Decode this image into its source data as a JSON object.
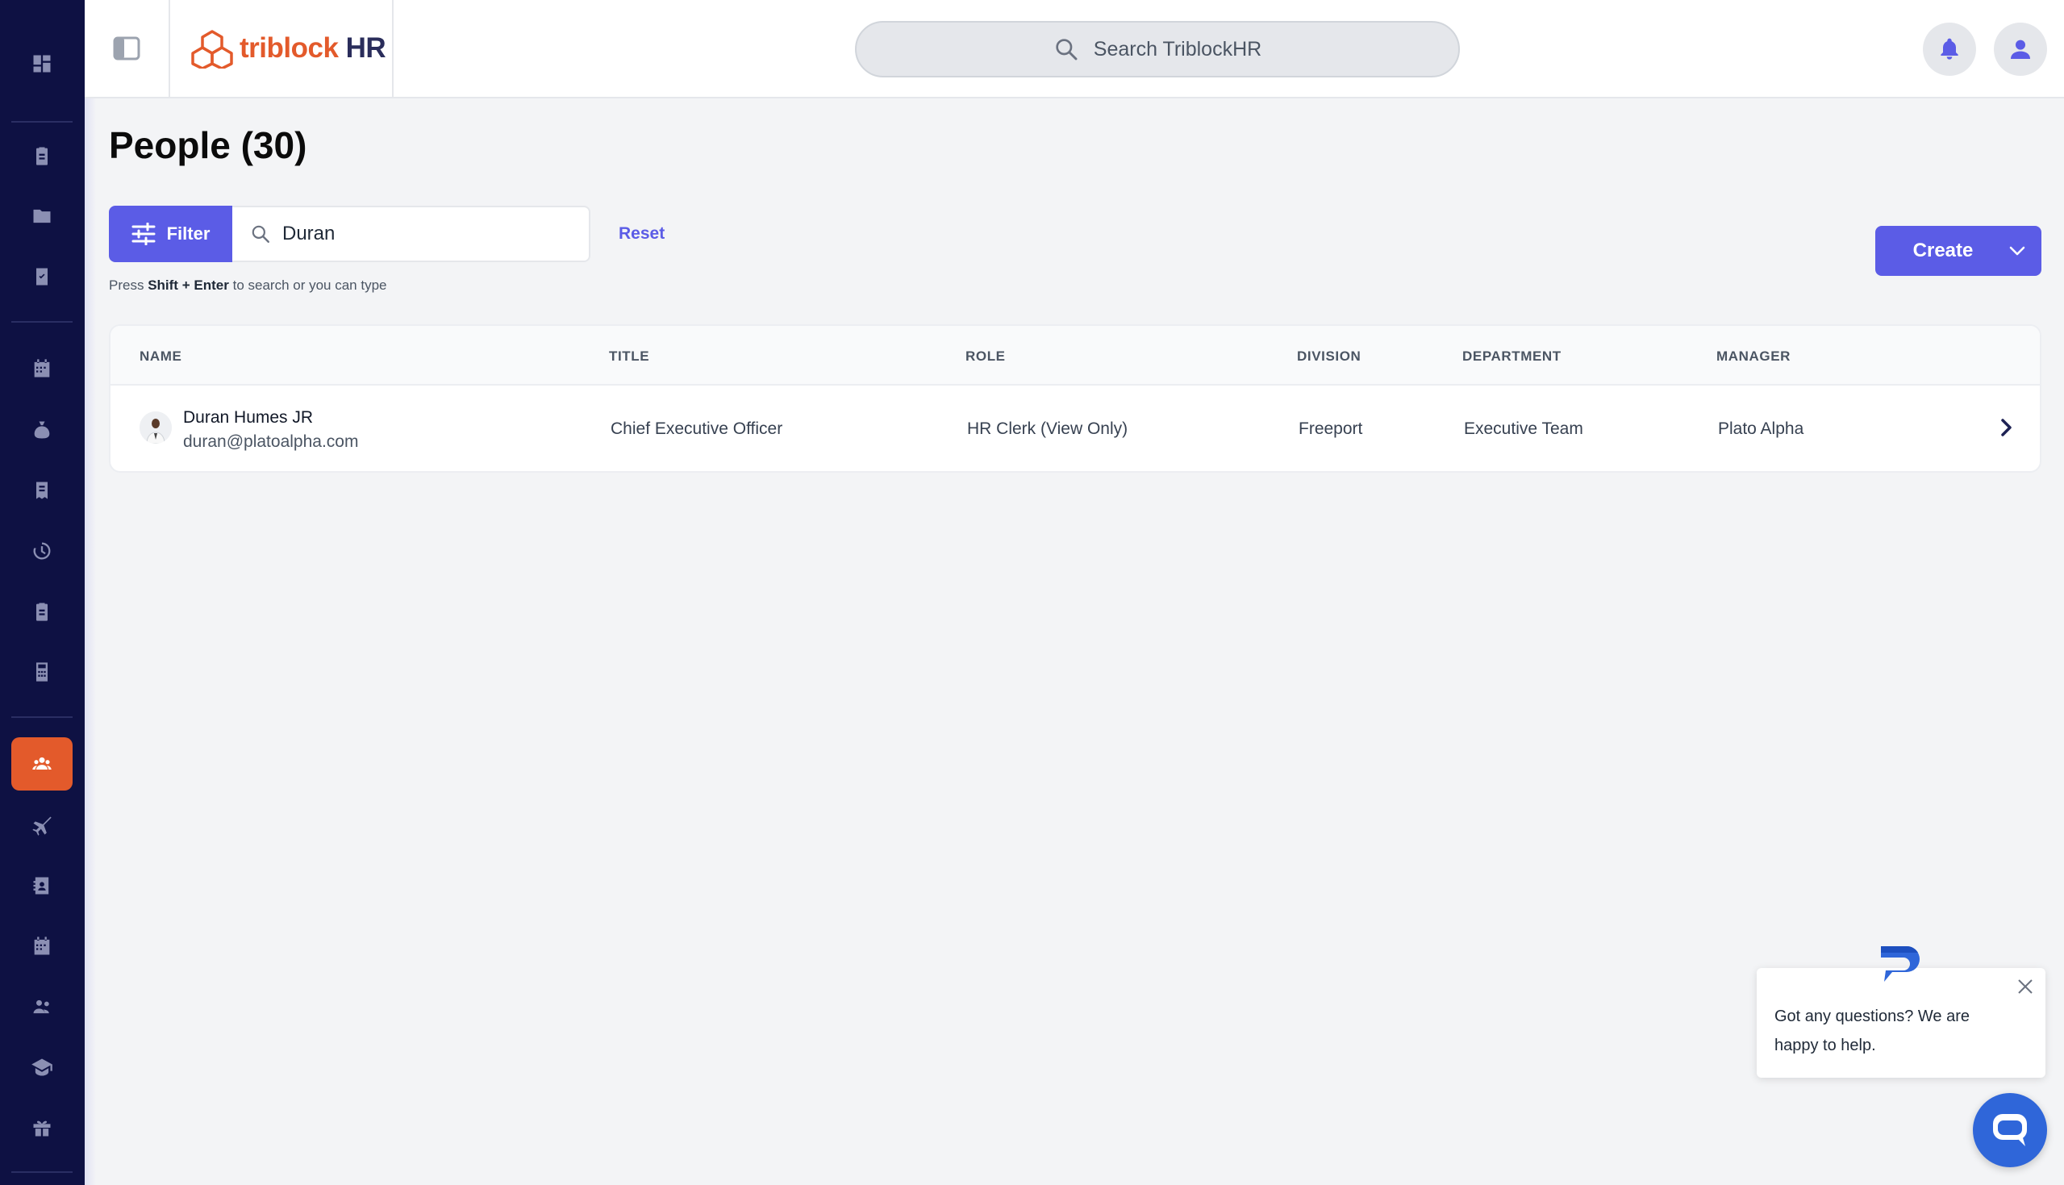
{
  "header": {
    "logo": {
      "part1": "triblock",
      "part2": "HR"
    },
    "search_placeholder": "Search TriblockHR"
  },
  "page": {
    "title": "People (30)"
  },
  "filter": {
    "button_label": "Filter",
    "search_value": "Duran",
    "reset_label": "Reset",
    "hint_prefix": "Press",
    "hint_key1": "Shift",
    "hint_plus": "+",
    "hint_key2": "Enter",
    "hint_suffix": "to search or you can type"
  },
  "create": {
    "label": "Create"
  },
  "table": {
    "columns": [
      "NAME",
      "TITLE",
      "ROLE",
      "DIVISION",
      "DEPARTMENT",
      "MANAGER"
    ],
    "rows": [
      {
        "name": "Duran Humes JR",
        "email": "duran@platoalpha.com",
        "title": "Chief Executive Officer",
        "role": "HR Clerk (View Only)",
        "division": "Freeport",
        "department": "Executive Team",
        "manager": "Plato Alpha"
      }
    ]
  },
  "chat": {
    "message": "Got any questions? We are happy to help."
  },
  "sidebar": {
    "icons": [
      "dashboard-icon",
      "clipboard-icon",
      "folder-icon",
      "task-check-icon",
      "calendar-icon",
      "money-bag-icon",
      "receipt-icon",
      "time-history-icon",
      "report-clipboard-icon",
      "calculator-icon",
      "people-icon",
      "airplane-icon",
      "contact-book-icon",
      "schedule-icon",
      "team-icon",
      "graduation-cap-icon",
      "gift-icon"
    ],
    "active": "people-icon"
  },
  "colors": {
    "sidebar_bg": "#0e1143",
    "accent": "#5b5ce6",
    "brand_orange": "#e35a2b",
    "chat_blue": "#2f66d9"
  }
}
